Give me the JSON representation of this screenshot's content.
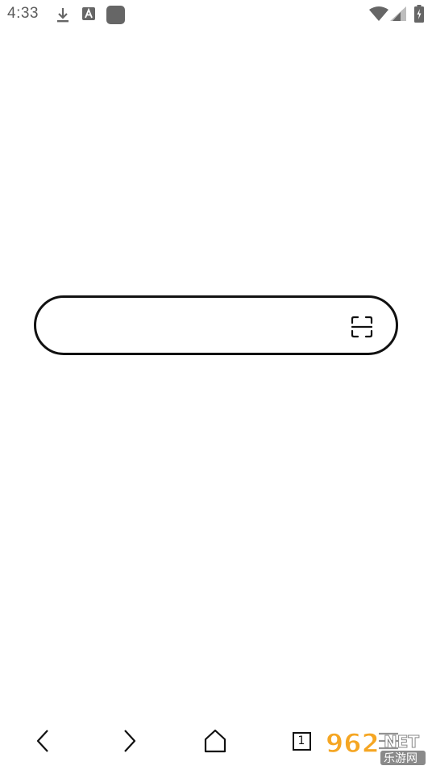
{
  "status_bar": {
    "time": "4:33",
    "icons": [
      "download-icon",
      "a-icon",
      "square-icon",
      "wifi-icon",
      "signal-icon",
      "battery-icon"
    ]
  },
  "search": {
    "value": "",
    "placeholder": "",
    "scan_icon": "scan-icon"
  },
  "bottom_nav": {
    "items": [
      {
        "icon": "chevron-left-icon"
      },
      {
        "icon": "chevron-right-icon"
      },
      {
        "icon": "home-icon"
      },
      {
        "icon": "tabs-icon",
        "count": "1"
      },
      {
        "icon": "menu-icon"
      }
    ]
  },
  "watermark": {
    "text_top": "962",
    "text_net": "NET",
    "text_bottom": "乐游网"
  },
  "colors": {
    "text": "#111111",
    "status_text": "#5c5c5c",
    "watermark_orange": "#f5a623"
  }
}
